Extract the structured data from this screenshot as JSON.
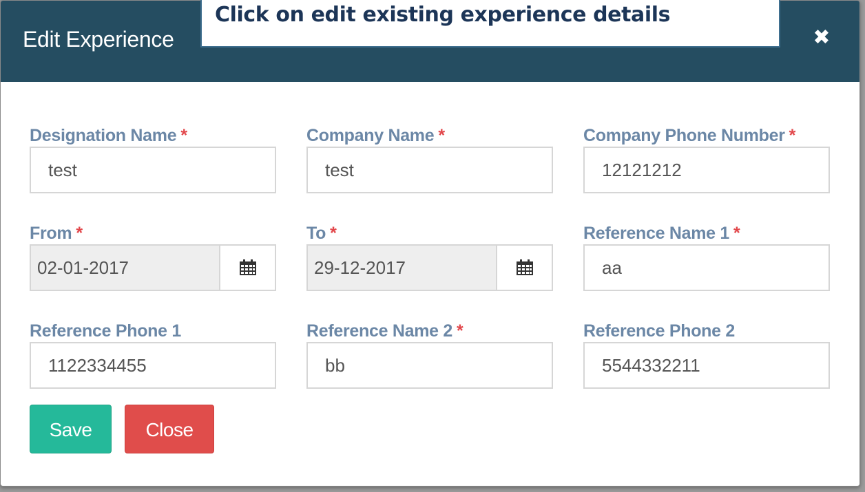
{
  "modal": {
    "title": "Edit Experience",
    "close_symbol": "✖",
    "close_icon": "close-icon"
  },
  "callout": {
    "text": "Click on edit existing experience details"
  },
  "fields": {
    "designation": {
      "label": "Designation Name",
      "required_mark": "*",
      "value": "test"
    },
    "company": {
      "label": "Company Name",
      "required_mark": "*",
      "value": "test"
    },
    "company_phone": {
      "label": "Company Phone Number",
      "required_mark": "*",
      "value": "12121212"
    },
    "from": {
      "label": "From",
      "required_mark": "*",
      "value": "02-01-2017",
      "icon": "calendar-icon"
    },
    "to": {
      "label": "To",
      "required_mark": "*",
      "value": "29-12-2017",
      "icon": "calendar-icon"
    },
    "ref_name_1": {
      "label": "Reference Name 1",
      "required_mark": "*",
      "value": "aa"
    },
    "ref_phone_1": {
      "label": "Reference Phone 1",
      "value": "1122334455"
    },
    "ref_name_2": {
      "label": "Reference Name 2",
      "required_mark": "*",
      "value": "bb"
    },
    "ref_phone_2": {
      "label": "Reference Phone 2",
      "value": "5544332211"
    }
  },
  "buttons": {
    "save": "Save",
    "close": "Close"
  },
  "colors": {
    "header_bg": "#254d61",
    "label": "#6b87a6",
    "required": "#e2474b",
    "save_bg": "#25b99a",
    "close_bg": "#e04d4b"
  }
}
